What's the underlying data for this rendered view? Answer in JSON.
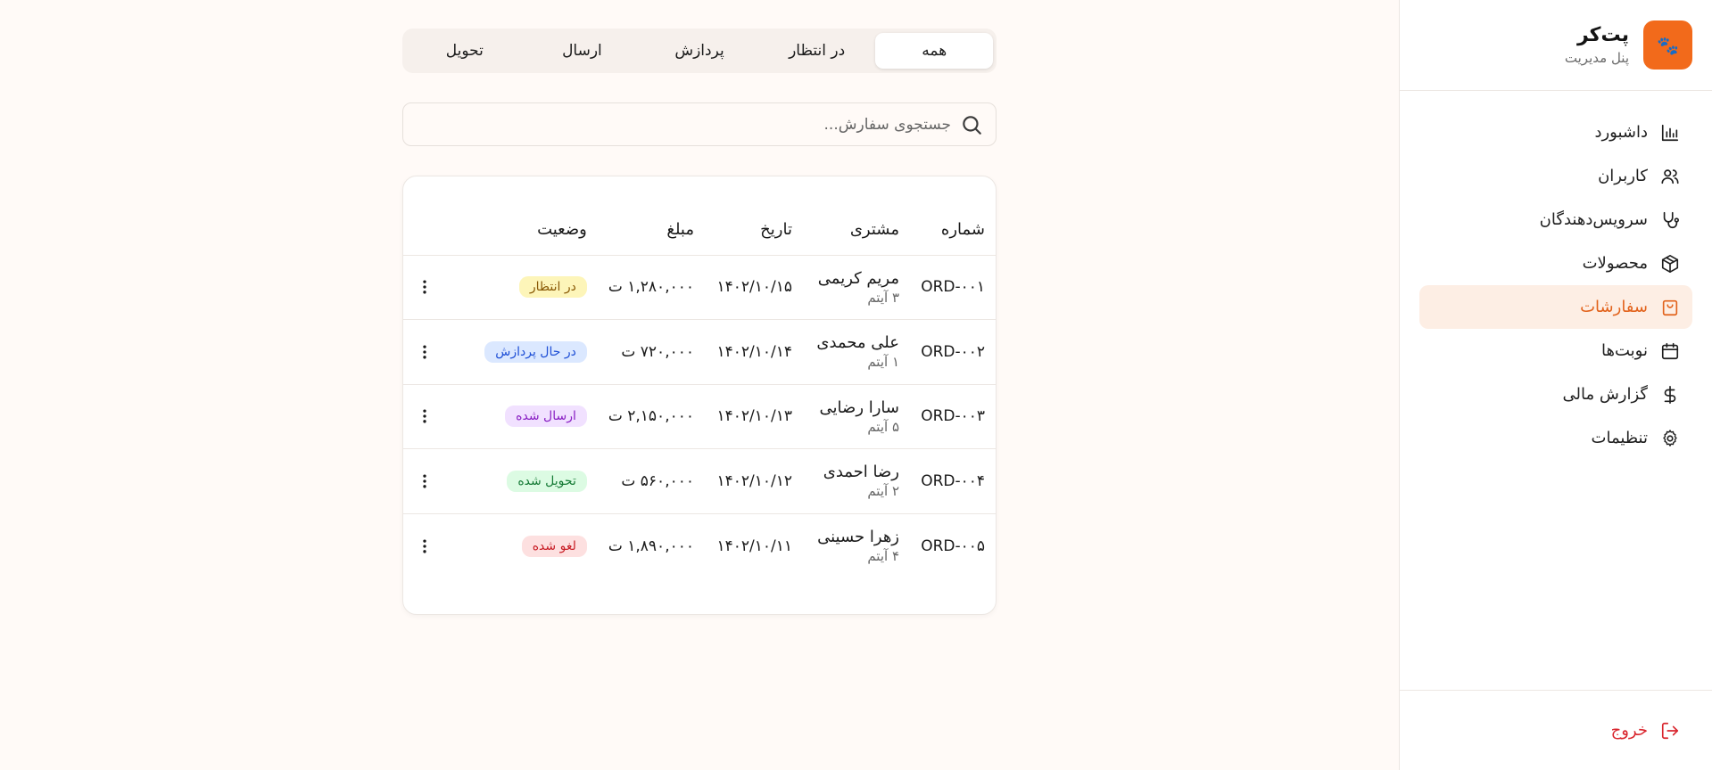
{
  "brand": {
    "logo_glyph": "🐾",
    "title": "پت‌کر",
    "subtitle": "پنل مدیریت",
    "color": "#f26a1b"
  },
  "sidebar": {
    "items": [
      {
        "label": "داشبورد",
        "icon": "bar-chart-icon"
      },
      {
        "label": "کاربران",
        "icon": "users-icon"
      },
      {
        "label": "سرویس‌دهندگان",
        "icon": "stethoscope-icon"
      },
      {
        "label": "محصولات",
        "icon": "package-icon"
      },
      {
        "label": "سفارشات",
        "icon": "shopping-bag-icon",
        "active": true
      },
      {
        "label": "نوبت‌ها",
        "icon": "calendar-icon"
      },
      {
        "label": "گزارش مالی",
        "icon": "dollar-icon"
      },
      {
        "label": "تنظیمات",
        "icon": "gear-icon"
      }
    ],
    "logout": "خروج"
  },
  "tabs": [
    {
      "label": "همه",
      "active": true
    },
    {
      "label": "در انتظار"
    },
    {
      "label": "پردازش"
    },
    {
      "label": "ارسال"
    },
    {
      "label": "تحویل"
    }
  ],
  "search": {
    "placeholder": "جستجوی سفارش...",
    "value": ""
  },
  "table": {
    "headers": {
      "number": "شماره",
      "customer": "مشتری",
      "date": "تاریخ",
      "amount": "مبلغ",
      "status": "وضعیت"
    },
    "rows": [
      {
        "number": "ORD-۰۰۱",
        "customer": "مریم کریمی",
        "items": "۳ آیتم",
        "date": "۱۴۰۲/۱۰/۱۵",
        "amount": "۱,۲۸۰,۰۰۰ ت",
        "status": "در انتظار",
        "status_key": "pending"
      },
      {
        "number": "ORD-۰۰۲",
        "customer": "علی محمدی",
        "items": "۱ آیتم",
        "date": "۱۴۰۲/۱۰/۱۴",
        "amount": "۷۲۰,۰۰۰ ت",
        "status": "در حال پردازش",
        "status_key": "processing"
      },
      {
        "number": "ORD-۰۰۳",
        "customer": "سارا رضایی",
        "items": "۵ آیتم",
        "date": "۱۴۰۲/۱۰/۱۳",
        "amount": "۲,۱۵۰,۰۰۰ ت",
        "status": "ارسال شده",
        "status_key": "shipped"
      },
      {
        "number": "ORD-۰۰۴",
        "customer": "رضا احمدی",
        "items": "۲ آیتم",
        "date": "۱۴۰۲/۱۰/۱۲",
        "amount": "۵۶۰,۰۰۰ ت",
        "status": "تحویل شده",
        "status_key": "delivered"
      },
      {
        "number": "ORD-۰۰۵",
        "customer": "زهرا حسینی",
        "items": "۴ آیتم",
        "date": "۱۴۰۲/۱۰/۱۱",
        "amount": "۱,۸۹۰,۰۰۰ ت",
        "status": "لغو شده",
        "status_key": "cancelled"
      }
    ]
  },
  "colors": {
    "accent": "#e2621b",
    "danger": "#d9262e",
    "active_bg": "#fdeee4"
  }
}
